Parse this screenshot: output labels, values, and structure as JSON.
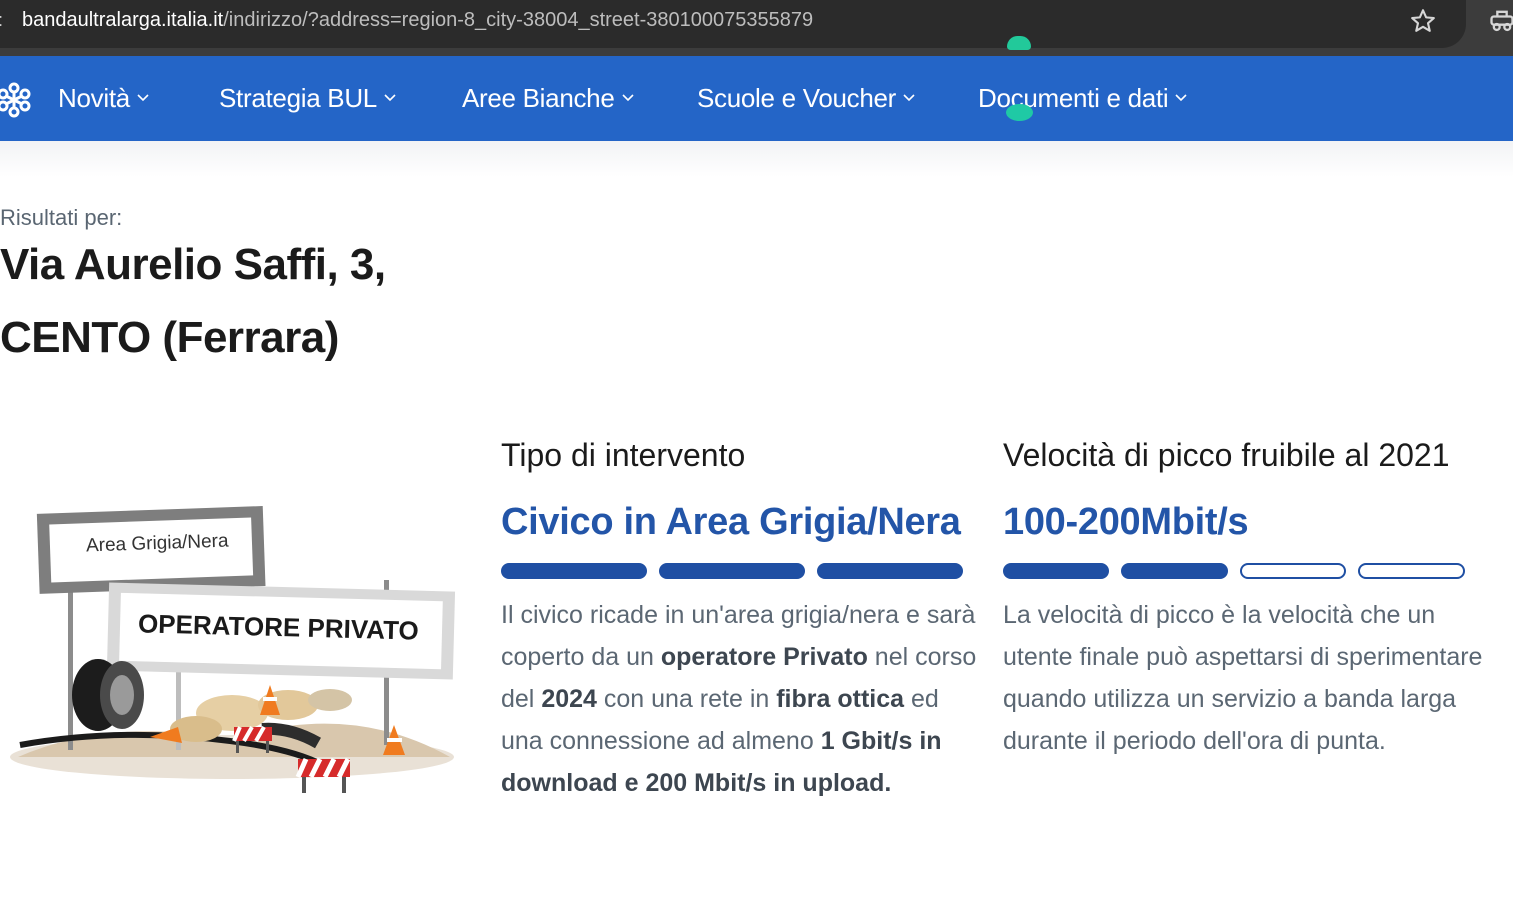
{
  "browser": {
    "url_host": "bandaultralarga.italia.it",
    "url_path": "/indirizzo/?address=region-8_city-38004_street-380100075355879",
    "icons": [
      "bookmark-star-icon",
      "extension-icon"
    ]
  },
  "nav": {
    "brand_icon": "network-logo-icon",
    "items": [
      {
        "label": "Novità"
      },
      {
        "label": "Strategia BUL"
      },
      {
        "label": "Aree Bianche"
      },
      {
        "label": "Scuole e Voucher"
      },
      {
        "label": "Documenti e dati"
      }
    ]
  },
  "results": {
    "label": "Risultati per:",
    "address_line1": "Via Aurelio Saffi, 3,",
    "address_line2": "CENTO (Ferrara)"
  },
  "illustration": {
    "sign_area": "Area Grigia/Nera",
    "sign_operator": "OPERATORE PRIVATO"
  },
  "intervention": {
    "title": "Tipo di intervento",
    "value": "Civico in Area Grigia/Nera",
    "level": {
      "filled": 3,
      "total": 3
    },
    "desc": [
      {
        "t": "Il civico ricade in un'area grigia/nera e sarà coperto da un ",
        "b": false
      },
      {
        "t": "operatore Privato",
        "b": true
      },
      {
        "t": " nel corso del ",
        "b": false
      },
      {
        "t": "2024",
        "b": true
      },
      {
        "t": " con una rete in ",
        "b": false
      },
      {
        "t": "fibra ottica",
        "b": true
      },
      {
        "t": " ed una connessione ad almeno ",
        "b": false
      },
      {
        "t": "1 Gbit/s in download e 200 Mbit/s in upload.",
        "b": true
      }
    ]
  },
  "speed": {
    "title": "Velocità di picco fruibile al 2021",
    "value": "100-200Mbit/s",
    "level": {
      "filled": 2,
      "total": 4
    },
    "desc": "La velocità di picco è la velocità che un utente finale può aspettarsi di sperimentare quando utilizza un servizio a banda larga durante il periodo dell'ora di punta."
  },
  "colors": {
    "nav_bg": "#2465c7",
    "accent": "#2355a8",
    "bar": "#1f4fa3",
    "body_text": "#5b6773"
  }
}
